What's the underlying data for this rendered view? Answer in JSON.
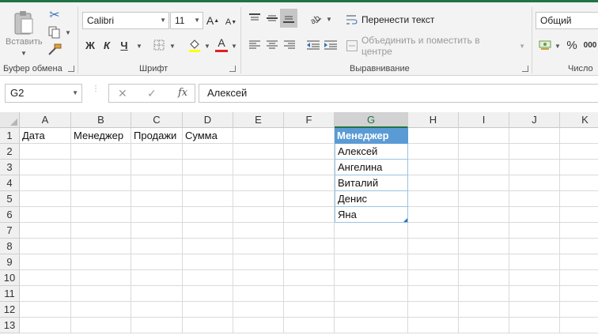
{
  "ribbon": {
    "clipboard": {
      "paste_label": "Вставить",
      "group_label": "Буфер обмена"
    },
    "font": {
      "font_name": "Calibri",
      "font_size": "11",
      "bold": "Ж",
      "italic": "К",
      "underline": "Ч",
      "grow": "A",
      "shrink": "A",
      "font_color_letter": "A",
      "group_label": "Шрифт",
      "font_color": "#e02020"
    },
    "alignment": {
      "wrap_text": "Перенести текст",
      "merge_center": "Объединить и поместить в центре",
      "group_label": "Выравнивание"
    },
    "number": {
      "format": "Общий",
      "percent": "%",
      "comma": "000",
      "group_label": "Число"
    },
    "accent_color": "#217346"
  },
  "formula_bar": {
    "name_box": "G2",
    "cancel": "✕",
    "enter": "✓",
    "fx": "fx",
    "value": "Алексей"
  },
  "grid": {
    "columns": [
      "A",
      "B",
      "C",
      "D",
      "E",
      "F",
      "G",
      "H",
      "I",
      "J",
      "K"
    ],
    "selected_column": "G",
    "rows": [
      "1",
      "2",
      "3",
      "4",
      "5",
      "6",
      "7",
      "8",
      "9",
      "10",
      "11",
      "12",
      "13"
    ],
    "row1": {
      "a": "Дата",
      "b": "Менеджер",
      "c": "Продажи",
      "d": "Сумма"
    },
    "table": {
      "header": "Менеджер",
      "items": [
        "Алексей",
        "Ангелина",
        "Виталий",
        "Денис",
        "Яна"
      ],
      "header_color": "#5b9bd5"
    }
  }
}
